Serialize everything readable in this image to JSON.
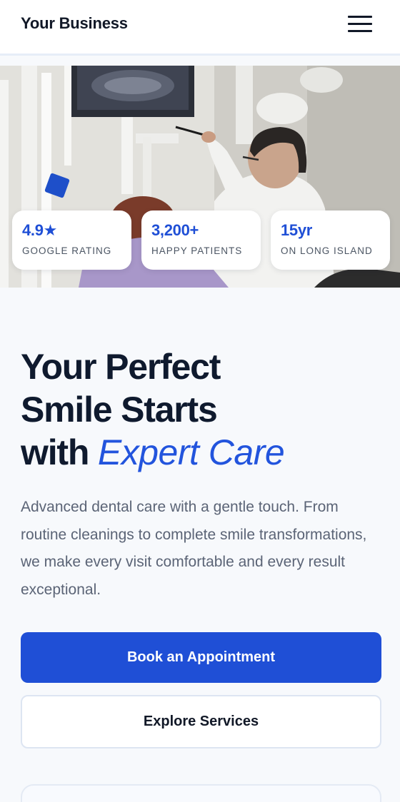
{
  "header": {
    "brand": "Your Business",
    "menu_icon": "hamburger-menu-icon"
  },
  "hero": {
    "image_description": "dentist-pointing-at-x-ray-monitor",
    "stats": [
      {
        "value": "4.9★",
        "label": "GOOGLE RATING"
      },
      {
        "value": "3,200+",
        "label": "HAPPY PATIENTS"
      },
      {
        "value": "15yr",
        "label": "ON LONG ISLAND"
      }
    ]
  },
  "headline": {
    "line1": "Your Perfect",
    "line2": "Smile Starts",
    "line3_plain": "with",
    "line3_accent": "Expert Care"
  },
  "lead": "Advanced dental care with a gentle touch. From routine cleanings to complete smile transformations, we make every visit comfortable and every result exceptional.",
  "cta": {
    "primary_label": "Book an Appointment",
    "secondary_label": "Explore Services"
  },
  "colors": {
    "accent": "#1f4fd6",
    "heading": "#0f1a2e",
    "body_text": "#5b6476",
    "background": "#f7f9fc"
  }
}
